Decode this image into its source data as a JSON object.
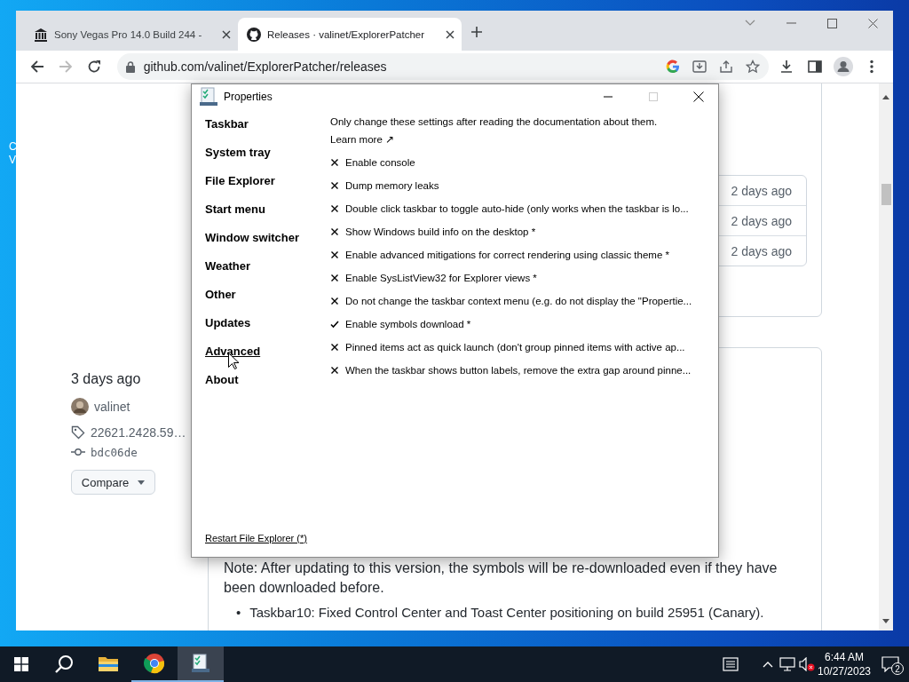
{
  "desktop": {
    "icon_label_fragments": [
      "C",
      "V"
    ]
  },
  "browser": {
    "tabs": [
      {
        "title": "Sony Vegas Pro 14.0 Build 244 -",
        "selected": false
      },
      {
        "title": "Releases · valinet/ExplorerPatcher",
        "selected": true
      }
    ],
    "address": "github.com/valinet/ExplorerPatcher/releases"
  },
  "page": {
    "release": {
      "date": "3 days ago",
      "author": "valinet",
      "tag": "22621.2428.59…",
      "commit": "bdc06de",
      "compare_button": "Compare"
    },
    "asset_dates": [
      "2 days ago",
      "2 days ago",
      "2 days ago"
    ],
    "note": "Note: After updating to this version, the symbols will be re-downloaded even if they have been downloaded before.",
    "bullets": [
      {
        "marker": "•",
        "text": "Taskbar10: Fixed Control Center and Toast Center positioning on build 25951 (Canary)."
      }
    ]
  },
  "dialog": {
    "title": "Properties",
    "nav": [
      {
        "label": "Taskbar",
        "selected": false
      },
      {
        "label": "System tray",
        "selected": false
      },
      {
        "label": "File Explorer",
        "selected": false
      },
      {
        "label": "Start menu",
        "selected": false
      },
      {
        "label": "Window switcher",
        "selected": false
      },
      {
        "label": "Weather",
        "selected": false
      },
      {
        "label": "Other",
        "selected": false
      },
      {
        "label": "Updates",
        "selected": false
      },
      {
        "label": "Advanced",
        "selected": true
      },
      {
        "label": "About",
        "selected": false
      }
    ],
    "intro": "Only change these settings after reading the documentation about them.",
    "learn_more": "Learn more ↗",
    "options": [
      {
        "label": "Enable console",
        "checked": false
      },
      {
        "label": "Dump memory leaks",
        "checked": false
      },
      {
        "label": "Double click taskbar to toggle auto-hide (only works when the taskbar is lo...",
        "checked": false
      },
      {
        "label": "Show Windows build info on the desktop *",
        "checked": false
      },
      {
        "label": "Enable advanced mitigations for correct rendering using classic theme *",
        "checked": false
      },
      {
        "label": "Enable SysListView32 for Explorer views *",
        "checked": false
      },
      {
        "label": "Do not change the taskbar context menu (e.g. do not display the \"Propertie...",
        "checked": false
      },
      {
        "label": "Enable symbols download *",
        "checked": true
      },
      {
        "label": "Pinned items act as quick launch (don't group pinned items with active ap...",
        "checked": false
      },
      {
        "label": "When the taskbar shows button labels, remove the extra gap around pinne...",
        "checked": false
      }
    ],
    "restart_link": "Restart File Explorer (*)"
  },
  "taskbar": {
    "apps": [
      {
        "kind": "folder",
        "running": false,
        "selected": false
      },
      {
        "kind": "chrome",
        "running": true,
        "selected": false
      },
      {
        "kind": "properties",
        "running": true,
        "selected": true
      }
    ],
    "volume_muted": true,
    "time": "6:44 AM",
    "date": "10/27/2023",
    "notification_count": "2"
  }
}
